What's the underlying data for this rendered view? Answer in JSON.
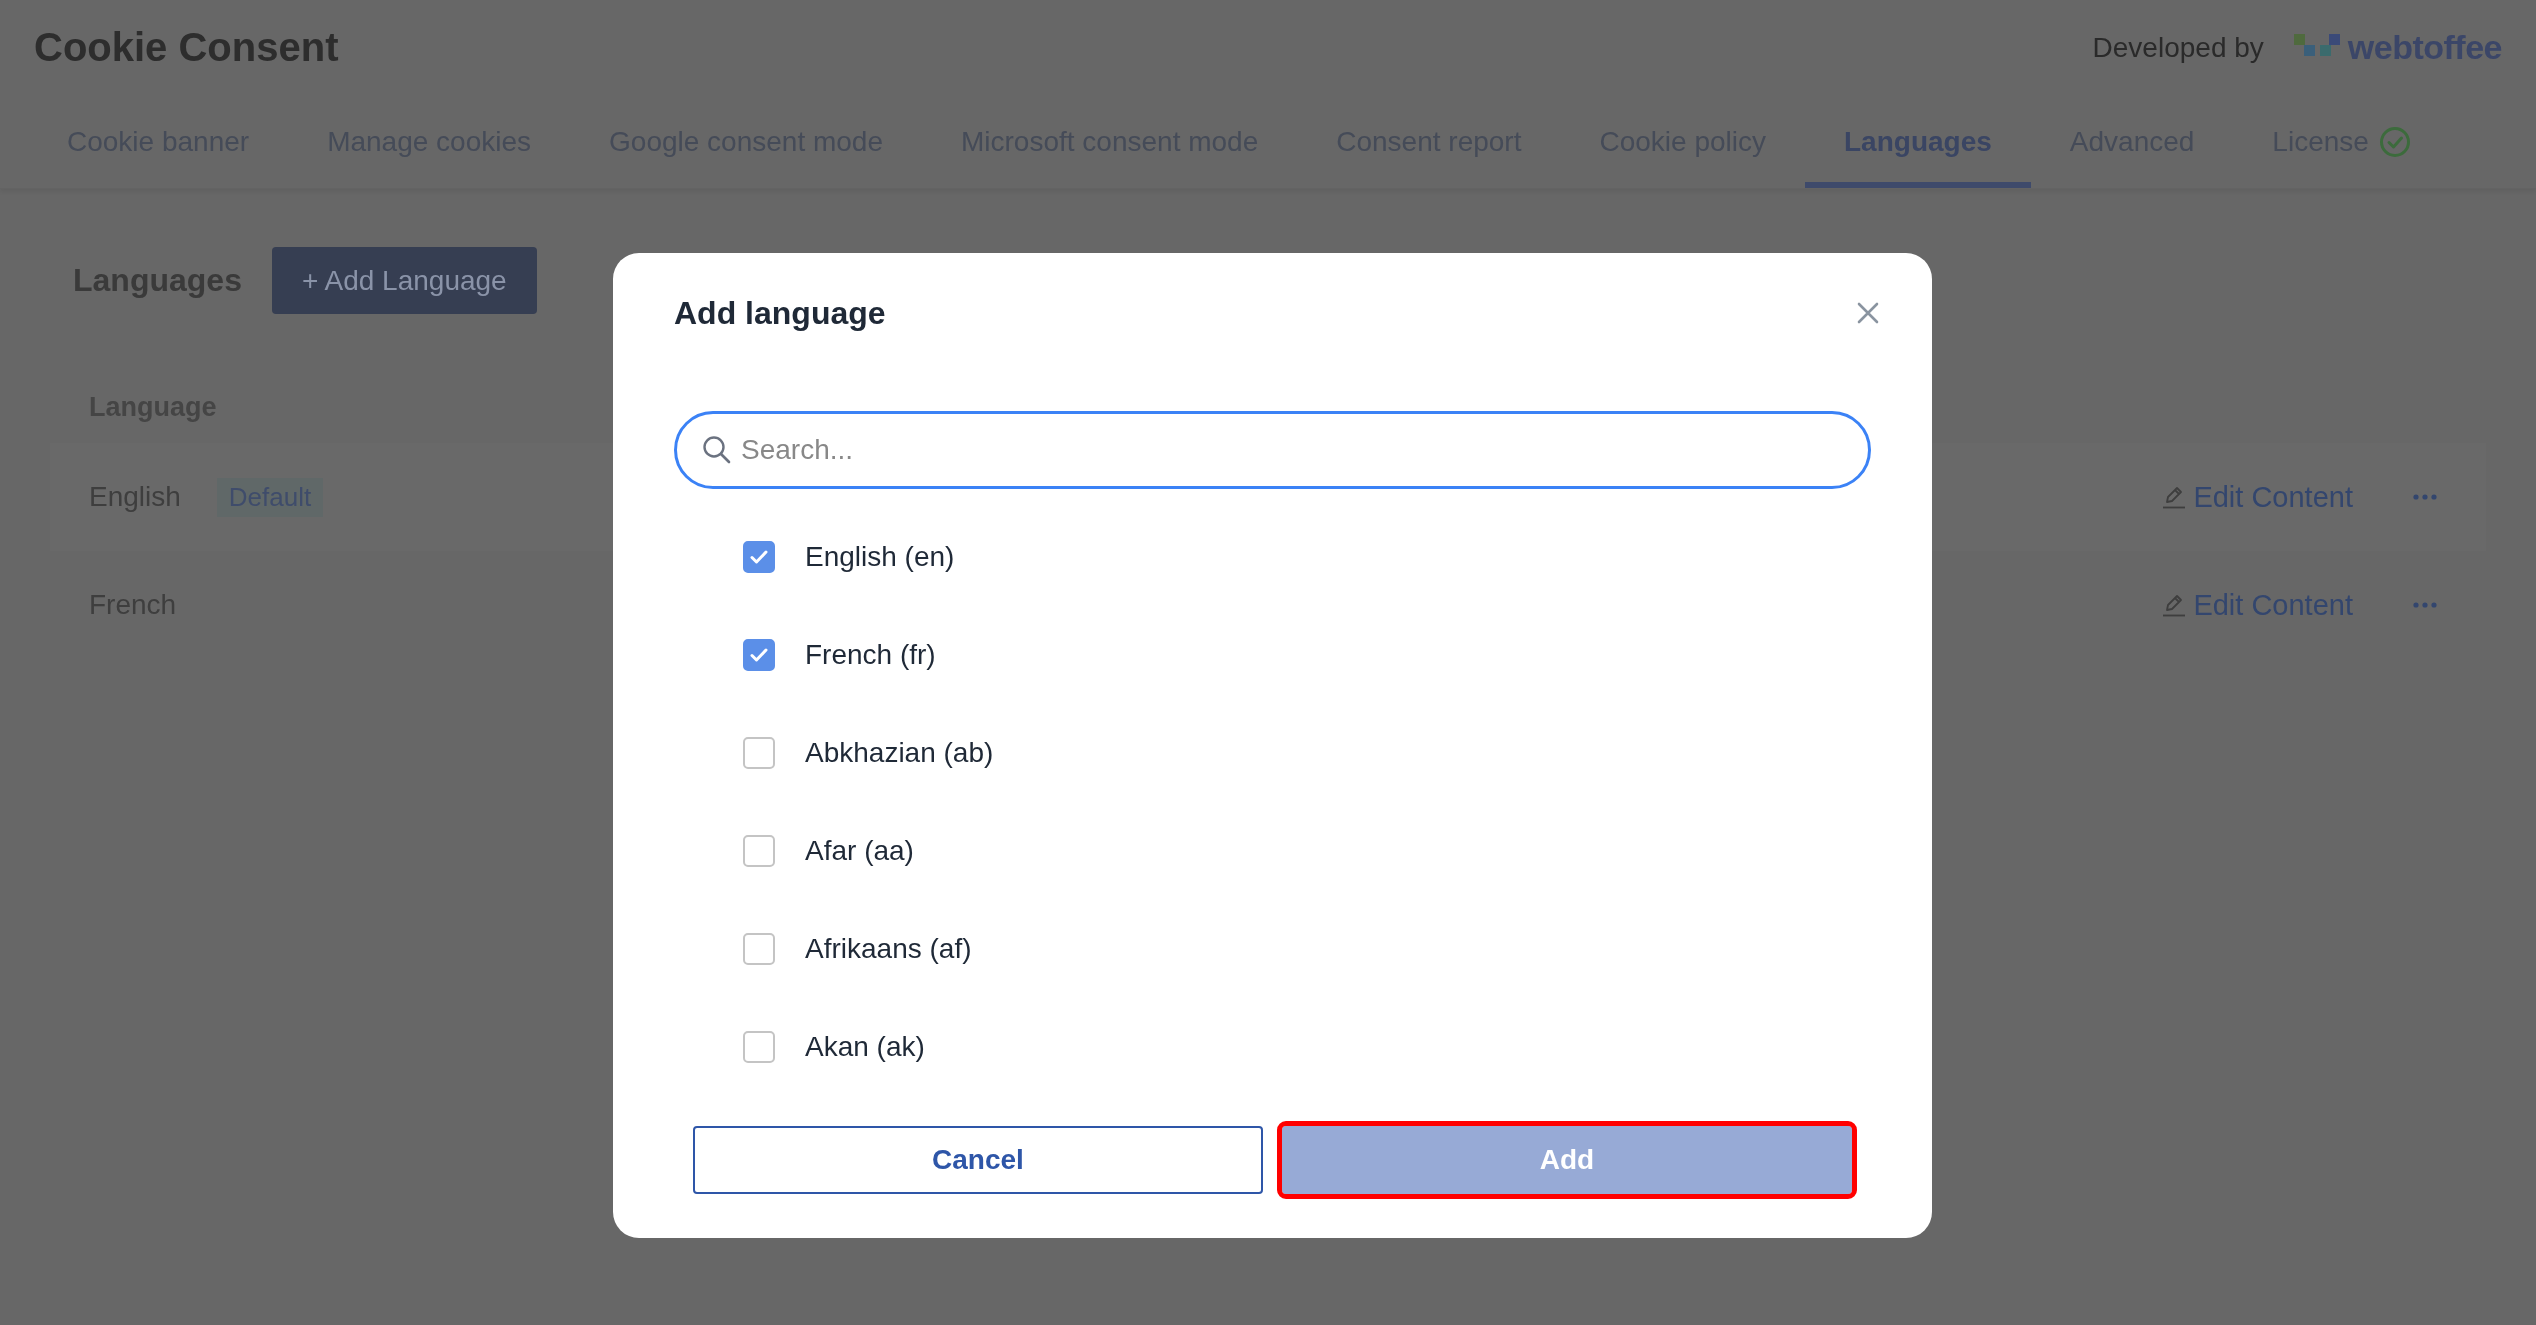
{
  "header": {
    "title": "Cookie Consent",
    "developed_by": "Developed by",
    "brand": "webtoffee"
  },
  "tabs": [
    {
      "label": "Cookie banner",
      "selected": false,
      "verified": false
    },
    {
      "label": "Manage cookies",
      "selected": false,
      "verified": false
    },
    {
      "label": "Google consent mode",
      "selected": false,
      "verified": false
    },
    {
      "label": "Microsoft consent mode",
      "selected": false,
      "verified": false
    },
    {
      "label": "Consent report",
      "selected": false,
      "verified": false
    },
    {
      "label": "Cookie policy",
      "selected": false,
      "verified": false
    },
    {
      "label": "Languages",
      "selected": true,
      "verified": false
    },
    {
      "label": "Advanced",
      "selected": false,
      "verified": false
    },
    {
      "label": "License",
      "selected": false,
      "verified": true
    }
  ],
  "page": {
    "heading": "Languages",
    "add_button": "+ Add Language",
    "table": {
      "columns": [
        "Language"
      ],
      "rows": [
        {
          "language": "English",
          "badge": "Default",
          "action": "Edit Content"
        },
        {
          "language": "French",
          "action": "Edit Content"
        }
      ]
    }
  },
  "modal": {
    "title": "Add language",
    "search": {
      "placeholder": "Search..."
    },
    "options": [
      {
        "label": "English (en)",
        "checked": true
      },
      {
        "label": "French (fr)",
        "checked": true
      },
      {
        "label": "Abkhazian (ab)",
        "checked": false
      },
      {
        "label": "Afar (aa)",
        "checked": false
      },
      {
        "label": "Afrikaans (af)",
        "checked": false
      },
      {
        "label": "Akan (ak)",
        "checked": false
      }
    ],
    "buttons": [
      {
        "label": "Cancel",
        "kind": "secondary",
        "highlighted": false
      },
      {
        "label": "Add",
        "kind": "primary",
        "highlighted": true
      }
    ]
  }
}
